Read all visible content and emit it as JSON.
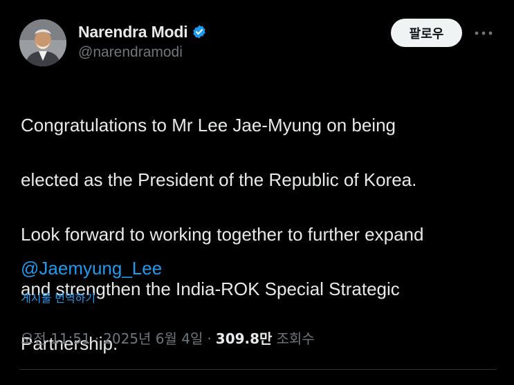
{
  "author": {
    "display_name": "Narendra Modi",
    "handle": "@narendramodi",
    "verified": true
  },
  "actions": {
    "follow_label": "팔로우",
    "more_icon": "more-horizontal-icon"
  },
  "tweet": {
    "lines": [
      "Congratulations to Mr Lee Jae-Myung on being",
      "elected as the President of the Republic of Korea.",
      "Look forward to working together to further expand",
      "and strengthen the India-ROK Special Strategic",
      "Partnership."
    ],
    "mention": "@Jaemyung_Lee",
    "translate_label": "게시물 번역하기"
  },
  "meta": {
    "time": "오전 11:51",
    "separator": "·",
    "date": "2025년 6월 4일",
    "views_count": "309.8만",
    "views_label": "조회수"
  },
  "colors": {
    "background": "#000000",
    "text": "#e7e9ea",
    "secondary": "#71767b",
    "accent": "#1d9bf0",
    "follow_bg": "#eff3f4"
  }
}
